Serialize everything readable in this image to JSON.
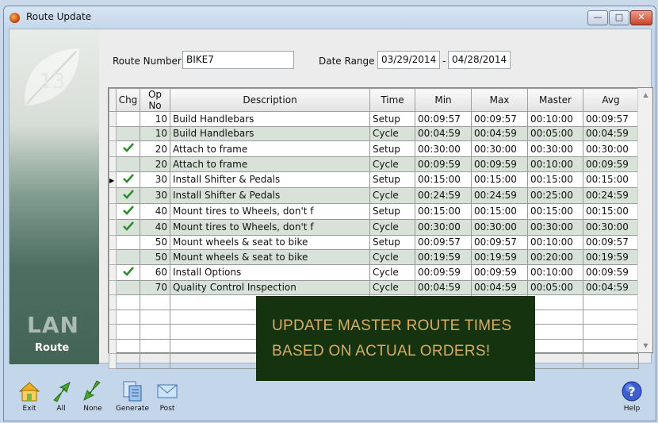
{
  "window": {
    "title": "Route Update"
  },
  "header": {
    "route_number_label": "Route Number",
    "route_number_value": "BIKE7",
    "date_range_label": "Date Range",
    "date_from": "03/29/2014",
    "date_sep": "-",
    "date_to": "04/28/2014"
  },
  "sidebar": {
    "brand": "LAN",
    "module": "Route",
    "leaf_number": "13"
  },
  "grid": {
    "columns": [
      "",
      "Chg",
      "Op No",
      "Description",
      "Time",
      "Min",
      "Max",
      "Master",
      "Avg"
    ],
    "rows": [
      {
        "chg": false,
        "op": "10",
        "desc": "Build Handlebars",
        "time": "Setup",
        "min": "00:09:57",
        "max": "00:09:57",
        "master": "00:10:00",
        "avg": "00:09:57"
      },
      {
        "chg": false,
        "op": "10",
        "desc": "Build Handlebars",
        "time": "Cycle",
        "min": "00:04:59",
        "max": "00:04:59",
        "master": "00:05:00",
        "avg": "00:04:59"
      },
      {
        "chg": true,
        "op": "20",
        "desc": "Attach to frame",
        "time": "Setup",
        "min": "00:30:00",
        "max": "00:30:00",
        "master": "00:30:00",
        "avg": "00:30:00"
      },
      {
        "chg": false,
        "op": "20",
        "desc": "Attach to frame",
        "time": "Cycle",
        "min": "00:09:59",
        "max": "00:09:59",
        "master": "00:10:00",
        "avg": "00:09:59"
      },
      {
        "chg": true,
        "op": "30",
        "desc": "Install Shifter & Pedals",
        "time": "Setup",
        "min": "00:15:00",
        "max": "00:15:00",
        "master": "00:15:00",
        "avg": "00:15:00",
        "current": true
      },
      {
        "chg": true,
        "op": "30",
        "desc": "Install Shifter & Pedals",
        "time": "Cycle",
        "min": "00:24:59",
        "max": "00:24:59",
        "master": "00:25:00",
        "avg": "00:24:59"
      },
      {
        "chg": true,
        "op": "40",
        "desc": "Mount tires to Wheels, don't f",
        "time": "Setup",
        "min": "00:15:00",
        "max": "00:15:00",
        "master": "00:15:00",
        "avg": "00:15:00"
      },
      {
        "chg": true,
        "op": "40",
        "desc": "Mount tires to Wheels, don't f",
        "time": "Cycle",
        "min": "00:30:00",
        "max": "00:30:00",
        "master": "00:30:00",
        "avg": "00:30:00"
      },
      {
        "chg": false,
        "op": "50",
        "desc": "Mount wheels & seat to bike",
        "time": "Setup",
        "min": "00:09:57",
        "max": "00:09:57",
        "master": "00:10:00",
        "avg": "00:09:57"
      },
      {
        "chg": false,
        "op": "50",
        "desc": "Mount wheels & seat to bike",
        "time": "Cycle",
        "min": "00:19:59",
        "max": "00:19:59",
        "master": "00:20:00",
        "avg": "00:19:59"
      },
      {
        "chg": true,
        "op": "60",
        "desc": "Install Options",
        "time": "Cycle",
        "min": "00:09:59",
        "max": "00:09:59",
        "master": "00:10:00",
        "avg": "00:09:59"
      },
      {
        "chg": false,
        "op": "70",
        "desc": "Quality Control Inspection",
        "time": "Cycle",
        "min": "00:04:59",
        "max": "00:04:59",
        "master": "00:05:00",
        "avg": "00:04:59"
      }
    ],
    "empty_rows": 5
  },
  "overlay": {
    "line1": "UPDATE MASTER ROUTE TIMES",
    "line2": "BASED ON ACTUAL ORDERS!"
  },
  "toolbar": {
    "exit": "Exit",
    "all": "All",
    "none": "None",
    "generate": "Generate",
    "post": "Post",
    "help": "Help"
  },
  "colors": {
    "overlay_bg": "#15330f",
    "overlay_text": "#d9ad63",
    "row_alt": "#d8e2d9",
    "check": "#2e8b2e"
  }
}
